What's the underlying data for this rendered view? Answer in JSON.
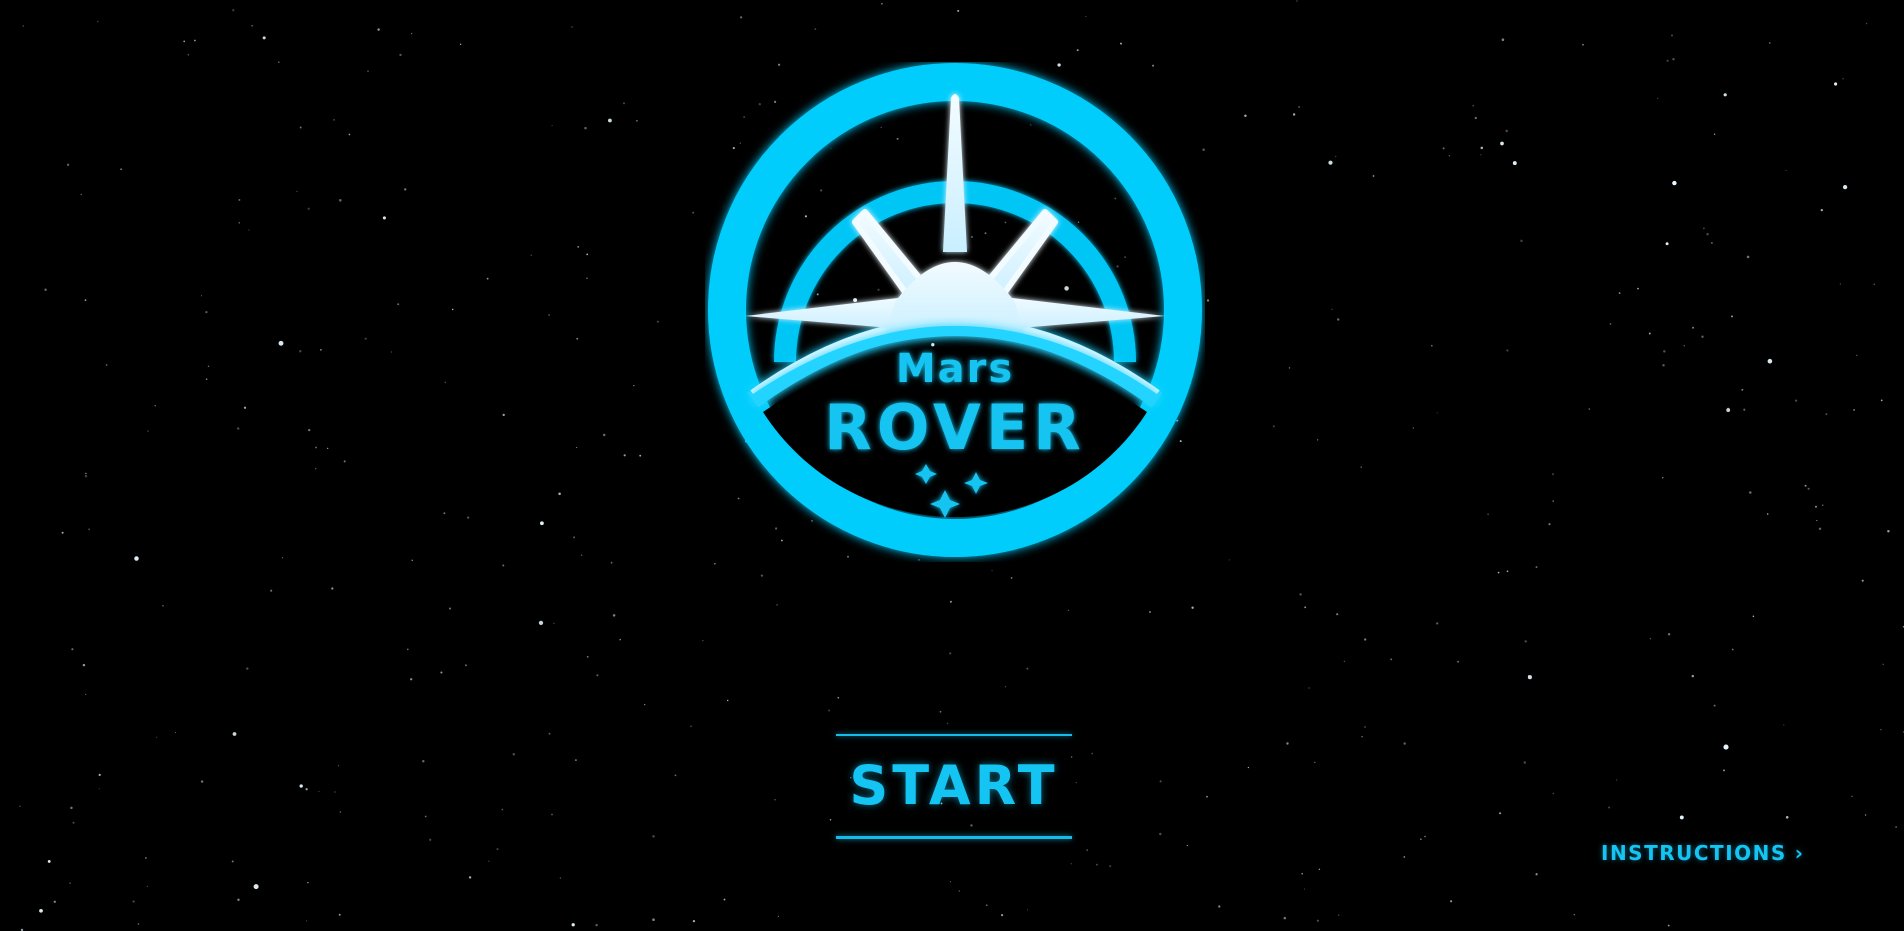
{
  "logo": {
    "title_small": "Mars",
    "title_large": "ROVER"
  },
  "menu": {
    "start_label": "START",
    "instructions_label": "INSTRUCTIONS",
    "instructions_chevron": "›"
  },
  "colors": {
    "background": "#000000",
    "accent": "#14c4f2",
    "star_white": "#e8f8ff"
  },
  "icons": {
    "emblem": "mars-rover-badge-icon",
    "sparkles": "sparkle-icon",
    "chevron": "chevron-right-icon"
  }
}
